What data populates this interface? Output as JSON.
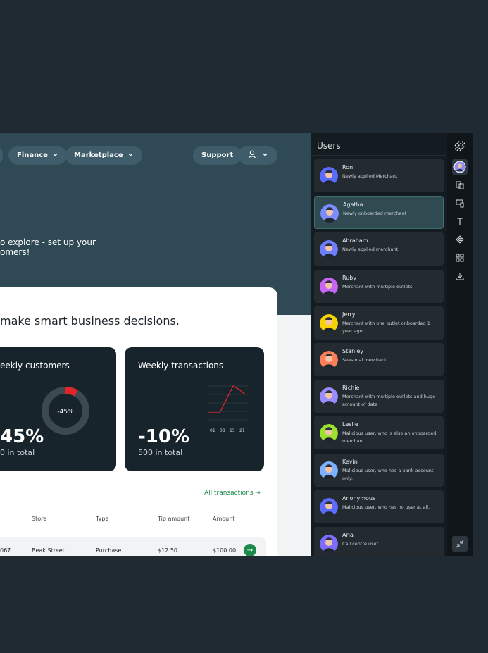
{
  "nav": {
    "items": [
      {
        "label": "Finance"
      },
      {
        "label": "Marketplace"
      }
    ],
    "support_label": "Support"
  },
  "hero": {
    "line1": "o explore - set up your",
    "line2": "omers!"
  },
  "headline": "make smart business decisions.",
  "tiles": {
    "customers": {
      "title": "eekly customers",
      "value": "45%",
      "sub": "0 in total",
      "donut_label": "-45%"
    },
    "transactions": {
      "title": "Weekly transactions",
      "value": "-10%",
      "sub": "500 in total",
      "ticks": [
        "01",
        "08",
        "15",
        "21"
      ]
    }
  },
  "all_transactions_label": "All transactions →",
  "table": {
    "headers": [
      "Store",
      "Type",
      "Tip amount",
      "Amount"
    ],
    "rows": [
      {
        "id": "067",
        "store": "Beak Street",
        "type": "Purchase",
        "tip": "$12.50",
        "amount": "$100.00"
      }
    ]
  },
  "users_panel": {
    "title": "Users",
    "users": [
      {
        "name": "Ron",
        "desc": "Newly applied Merchant",
        "color": "#5a6cff"
      },
      {
        "name": "Agatha",
        "desc": "Newly onboarded merchant",
        "color": "#7b8cff",
        "selected": true
      },
      {
        "name": "Abraham",
        "desc": "Newly applied merchant.",
        "color": "#6f7dff"
      },
      {
        "name": "Ruby",
        "desc": "Merchant with multiple outlets",
        "color": "#c765f5"
      },
      {
        "name": "Jerry",
        "desc": "Merchant with one outlet onboarded 1 year ago",
        "color": "#f5d200"
      },
      {
        "name": "Stanley",
        "desc": "Seasonal merchant",
        "color": "#ff7e5a"
      },
      {
        "name": "Richie",
        "desc": "Merchant with multiple outlets and huge amount of data",
        "color": "#9b8cff"
      },
      {
        "name": "Leslie",
        "desc": "Malicious user, who is also an onboarded merchant.",
        "color": "#9be030"
      },
      {
        "name": "Kevin",
        "desc": "Malicious user, who has a bank account only.",
        "color": "#7fb0ff"
      },
      {
        "name": "Anonymous",
        "desc": "Malicious user, who has no user at all.",
        "color": "#5b6cff"
      },
      {
        "name": "Aria",
        "desc": "Call centre user",
        "color": "#7c6dff"
      }
    ]
  },
  "colors": {
    "accent_green": "#1c8a4b",
    "donut_red": "#e0262b",
    "dark_tile": "#17242c"
  }
}
